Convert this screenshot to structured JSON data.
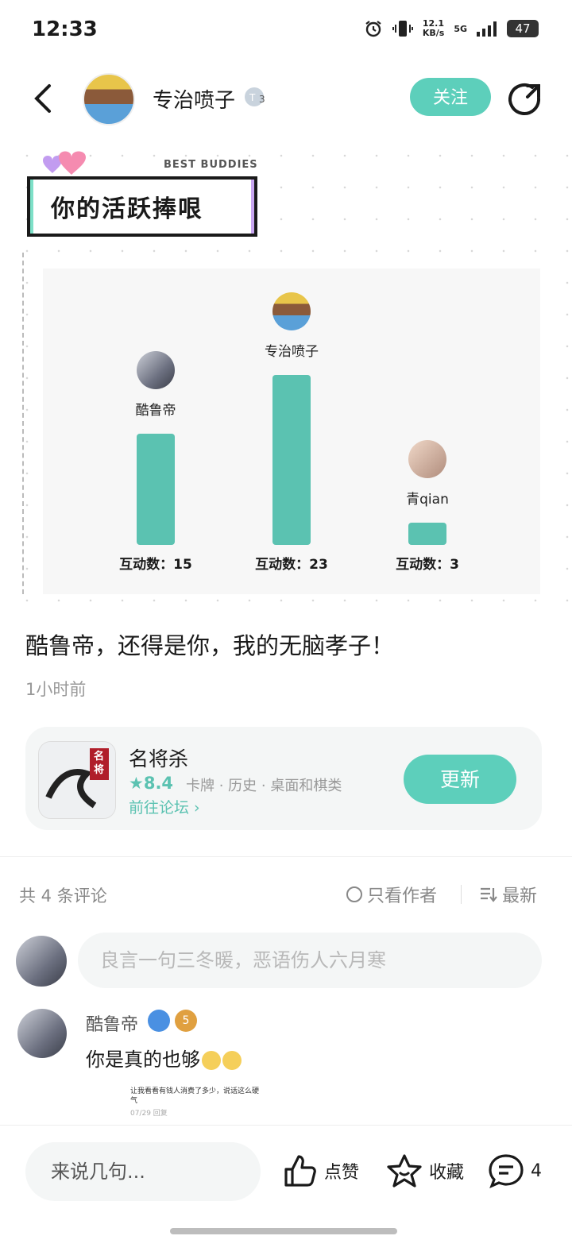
{
  "status_bar": {
    "time": "12:33",
    "speed_value": "12.1",
    "speed_unit": "KB/s",
    "network": "5G",
    "battery": "47"
  },
  "header": {
    "user_name": "专治喷子",
    "level": "3",
    "follow_label": "关注"
  },
  "banner": {
    "tag": "BEST BUDDIES",
    "title": "你的活跃捧哏"
  },
  "chart": {
    "bars": [
      {
        "name": "酷鲁帝",
        "count_label": "互动数：15"
      },
      {
        "name": "专治喷子",
        "count_label": "互动数：23"
      },
      {
        "name": "青qian",
        "count_label": "互动数：3"
      }
    ]
  },
  "chart_data": {
    "type": "bar",
    "categories": [
      "酷鲁帝",
      "专治喷子",
      "青qian"
    ],
    "values": [
      15,
      23,
      3
    ]
  },
  "post": {
    "text": "酷鲁帝，还得是你，我的无脑孝子！",
    "time": "1小时前"
  },
  "app_card": {
    "name": "名将杀",
    "rating": "8.4",
    "tags": "卡牌 · 历史 · 桌面和棋类",
    "forum_link": "前往论坛",
    "update_label": "更新",
    "icon_text": "名将"
  },
  "comments": {
    "count_label": "共 4 条评论",
    "author_only_label": "只看作者",
    "sort_label": "最新",
    "input_placeholder": "良言一句三冬暖，恶语伤人六月寒",
    "items": [
      {
        "name": "酷鲁帝",
        "level": "5",
        "text": "你是真的也够",
        "shot_text": "让我看看有钱人消费了多少，说话这么硬气",
        "shot_meta": "07/29  回复"
      }
    ]
  },
  "bottom_bar": {
    "input_placeholder": "来说几句...",
    "like_label": "点赞",
    "favorite_label": "收藏",
    "comment_count": "4"
  },
  "colors": {
    "accent": "#5dcfbb",
    "bar": "#5bc2b1"
  }
}
